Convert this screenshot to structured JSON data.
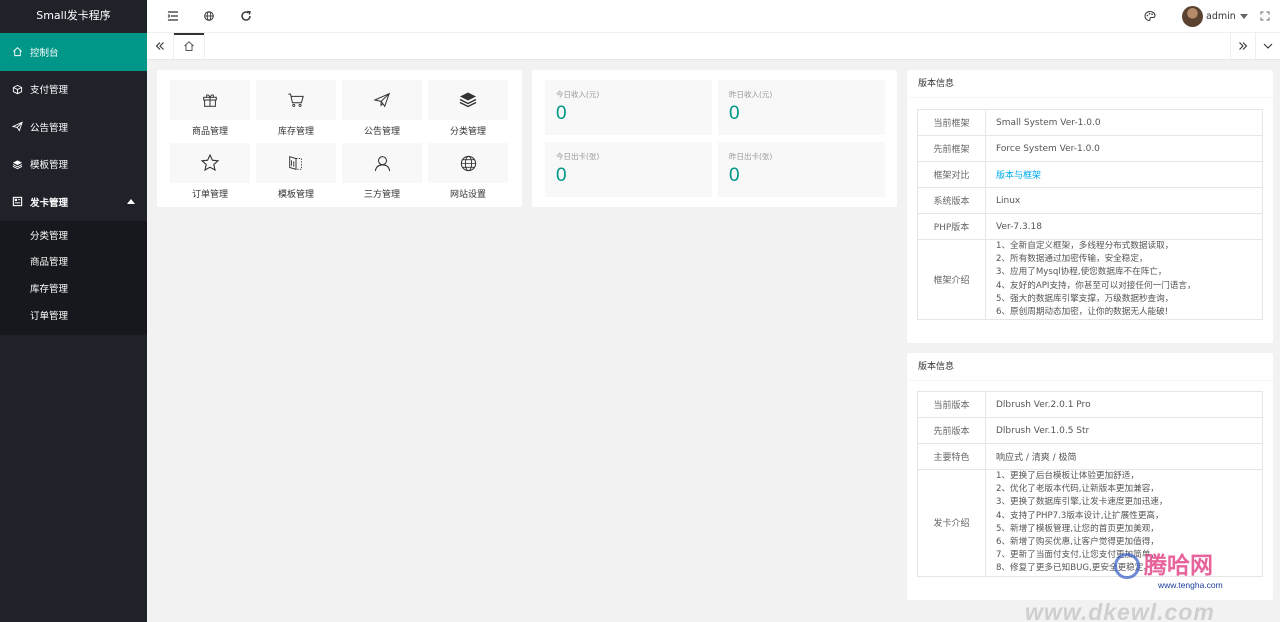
{
  "app": {
    "title": "Small发卡程序"
  },
  "sidebar": {
    "items": [
      {
        "label": "控制台",
        "icon": "home-icon"
      },
      {
        "label": "支付管理",
        "icon": "cube-icon"
      },
      {
        "label": "公告管理",
        "icon": "paper-plane-icon"
      },
      {
        "label": "模板管理",
        "icon": "layers-icon"
      },
      {
        "label": "发卡管理",
        "icon": "cards-icon"
      }
    ],
    "subitems": [
      "分类管理",
      "商品管理",
      "库存管理",
      "订单管理"
    ]
  },
  "header": {
    "username": "admin"
  },
  "quick": [
    {
      "label": "商品管理",
      "icon": "gift-icon"
    },
    {
      "label": "库存管理",
      "icon": "cart-icon"
    },
    {
      "label": "公告管理",
      "icon": "paper-plane-icon"
    },
    {
      "label": "分类管理",
      "icon": "layers-icon"
    },
    {
      "label": "订单管理",
      "icon": "star-icon"
    },
    {
      "label": "模板管理",
      "icon": "template-icon"
    },
    {
      "label": "三方管理",
      "icon": "user-icon"
    },
    {
      "label": "网站设置",
      "icon": "globe-icon"
    }
  ],
  "stats": [
    {
      "label": "今日收入(元)",
      "value": "0"
    },
    {
      "label": "昨日收入(元)",
      "value": "0"
    },
    {
      "label": "今日出卡(张)",
      "value": "0"
    },
    {
      "label": "昨日出卡(张)",
      "value": "0"
    }
  ],
  "framework": {
    "title": "版本信息",
    "rows": [
      {
        "k": "当前框架",
        "v": "Small System Ver-1.0.0"
      },
      {
        "k": "先前框架",
        "v": "Force System Ver-1.0.0"
      },
      {
        "k": "框架对比",
        "v": "版本与框架"
      },
      {
        "k": "系统版本",
        "v": "Linux"
      },
      {
        "k": "PHP版本",
        "v": "Ver-7.3.18"
      }
    ],
    "intro_label": "框架介绍",
    "intro": [
      "1、全新自定义框架，多线程分布式数据读取，",
      "2、所有数据通过加密传输，安全稳定，",
      "3、应用了Mysql协程,使您数据库不在阵亡，",
      "4、友好的API支持，你甚至可以对接任何一门语言，",
      "5、强大的数据库引擎支撑，万级数据秒查询，",
      "6、原创周期动态加密，让你的数据无人能破!"
    ]
  },
  "version": {
    "title": "版本信息",
    "rows": [
      {
        "k": "当前版本",
        "v": "Dlbrush Ver.2.0.1 Pro"
      },
      {
        "k": "先前版本",
        "v": "Dlbrush Ver.1.0.5 Str"
      },
      {
        "k": "主要特色",
        "v": "响应式 / 清爽 / 极简"
      }
    ],
    "intro_label": "发卡介绍",
    "intro": [
      "1、更换了后台模板让体验更加舒适，",
      "2、优化了老版本代码,让新版本更加兼容，",
      "3、更换了数据库引擎,让发卡速度更加迅速，",
      "4、支持了PHP7.3版本设计,让扩展性更高，",
      "5、新增了模板管理,让您的首页更加美观，",
      "6、新增了购买优惠,让客户觉得更加值得，",
      "7、更新了当面付支付,让您支付更加简单，",
      "8、修复了更多已知BUG,更安全更稳定。"
    ]
  },
  "watermark": {
    "cn": "腾哈网",
    "url": "www.tengha.com",
    "domain": "www.dkewl.com"
  }
}
